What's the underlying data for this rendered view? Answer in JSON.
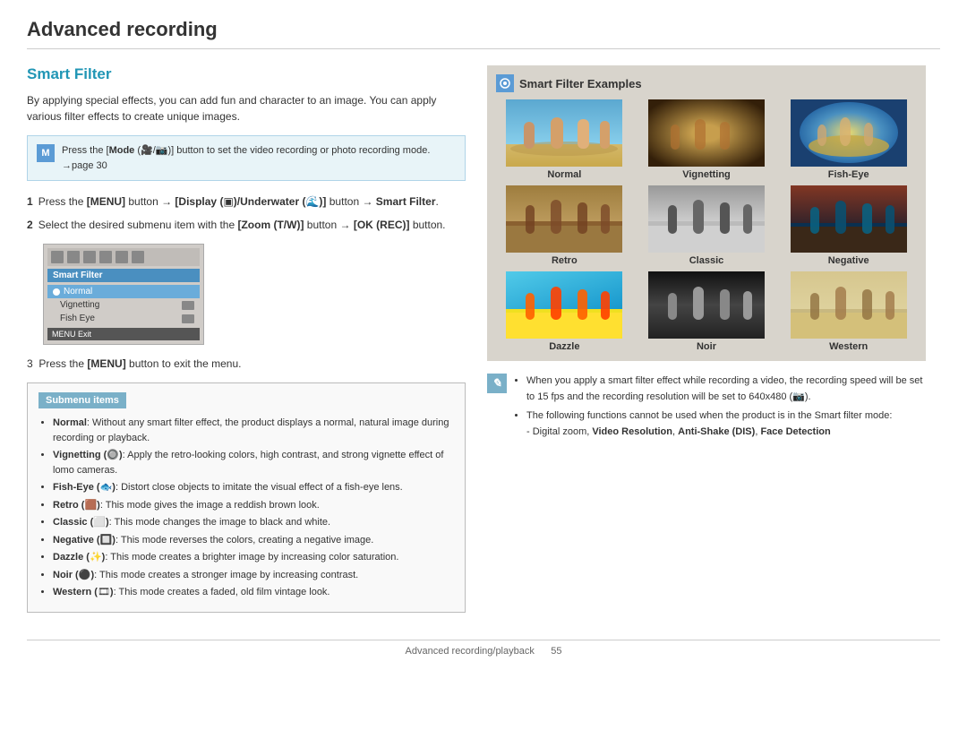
{
  "page": {
    "title": "Advanced recording",
    "footer_text": "Advanced recording/playback",
    "footer_page": "55"
  },
  "left": {
    "section_title": "Smart Filter",
    "intro_text": "By applying special effects, you can add fun and character to an image. You can apply various filter effects to create unique images.",
    "note": {
      "text": "Press the [Mode (      )] button to set the video recording or photo recording mode. →page 30"
    },
    "steps": [
      {
        "num": "1",
        "text": "Press the [MENU] button → [Display (      )/Underwater (      )] button → Smart Filter."
      },
      {
        "num": "2",
        "text": "Select the desired submenu item with the [Zoom (T/W)] button → [OK (REC)] button."
      }
    ],
    "step3": "3  Press the [MENU] button to exit the menu.",
    "submenu": {
      "title": "Submenu items",
      "items": [
        {
          "label": "Normal",
          "desc": ": Without any smart filter effect, the product displays a normal, natural image during recording or playback."
        },
        {
          "label": "Vignetting",
          "desc": ": Apply the retro-looking colors, high contrast, and strong vignette effect of lomo cameras."
        },
        {
          "label": "Fish-Eye",
          "desc": ": Distort close objects to imitate the visual effect of a fish-eye lens."
        },
        {
          "label": "Retro",
          "desc": ": This mode gives the image a reddish brown look."
        },
        {
          "label": "Classic",
          "desc": ": This mode changes the image to black and white."
        },
        {
          "label": "Negative",
          "desc": ": This mode reverses the colors, creating a negative image."
        },
        {
          "label": "Dazzle",
          "desc": ": This mode creates a brighter image by increasing color saturation."
        },
        {
          "label": "Noir",
          "desc": ": This mode creates a stronger image by increasing contrast."
        },
        {
          "label": "Western",
          "desc": ": This mode creates a faded, old film vintage look."
        }
      ]
    }
  },
  "right": {
    "examples_title": "Smart Filter Examples",
    "filters": [
      {
        "label": "Normal",
        "style": "normal"
      },
      {
        "label": "Vignetting",
        "style": "vignetting"
      },
      {
        "label": "Fish-Eye",
        "style": "fisheye"
      },
      {
        "label": "Retro",
        "style": "retro"
      },
      {
        "label": "Classic",
        "style": "classic"
      },
      {
        "label": "Negative",
        "style": "negative"
      },
      {
        "label": "Dazzle",
        "style": "dazzle"
      },
      {
        "label": "Noir",
        "style": "noir"
      },
      {
        "label": "Western",
        "style": "western"
      }
    ],
    "info_notes": [
      "When you apply a smart filter effect while recording a video, the recording speed will be set to 15 fps and the recording resolution will be set to 640x480 (     ).",
      "The following functions cannot be used when the product is in the Smart filter mode:",
      "- Digital zoom, Video Resolution, Anti-Shake (DIS), Face Detection"
    ]
  }
}
